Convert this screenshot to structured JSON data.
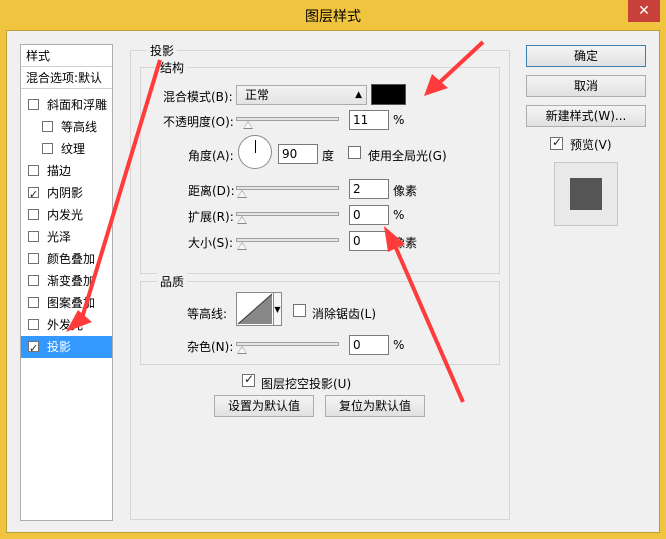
{
  "window": {
    "title": "图层样式",
    "close_glyph": "✕"
  },
  "left": {
    "header_styles": "样式",
    "header_blend": "混合选项:默认",
    "items": [
      {
        "label": "斜面和浮雕",
        "checked": false
      },
      {
        "label": "等高线",
        "checked": false
      },
      {
        "label": "纹理",
        "checked": false
      },
      {
        "label": "描边",
        "checked": false
      },
      {
        "label": "内阴影",
        "checked": true
      },
      {
        "label": "内发光",
        "checked": false
      },
      {
        "label": "光泽",
        "checked": false
      },
      {
        "label": "颜色叠加",
        "checked": false
      },
      {
        "label": "渐变叠加",
        "checked": false
      },
      {
        "label": "图案叠加",
        "checked": false
      },
      {
        "label": "外发光",
        "checked": false
      },
      {
        "label": "投影",
        "checked": true
      }
    ]
  },
  "drop_shadow": {
    "section_title": "投影",
    "structure_title": "结构",
    "blend_mode_label": "混合模式(B):",
    "blend_mode_value": "正常",
    "blend_color": "#000000",
    "opacity_label": "不透明度(O):",
    "opacity_value": "11",
    "opacity_unit": "%",
    "opacity_fraction": 0.11,
    "angle_label": "角度(A):",
    "angle_value": "90",
    "angle_unit": "度",
    "global_light_label": "使用全局光(G)",
    "distance_label": "距离(D):",
    "distance_value": "2",
    "distance_unit": "像素",
    "spread_label": "扩展(R):",
    "spread_value": "0",
    "spread_unit": "%",
    "size_label": "大小(S):",
    "size_value": "0",
    "size_unit": "像素",
    "quality_title": "品质",
    "contour_label": "等高线:",
    "antialias_label": "消除锯齿(L)",
    "noise_label": "杂色(N):",
    "noise_value": "0",
    "noise_unit": "%",
    "knockout_label": "图层挖空投影(U)",
    "set_default_label": "设置为默认值",
    "reset_default_label": "复位为默认值"
  },
  "buttons": {
    "ok": "确定",
    "cancel": "取消",
    "new_style": "新建样式(W)...",
    "preview_label": "预览(V)"
  },
  "colors": {
    "accent": "#3399ff",
    "title_bar": "#f0c43f",
    "arrow": "#ff3b3b"
  }
}
